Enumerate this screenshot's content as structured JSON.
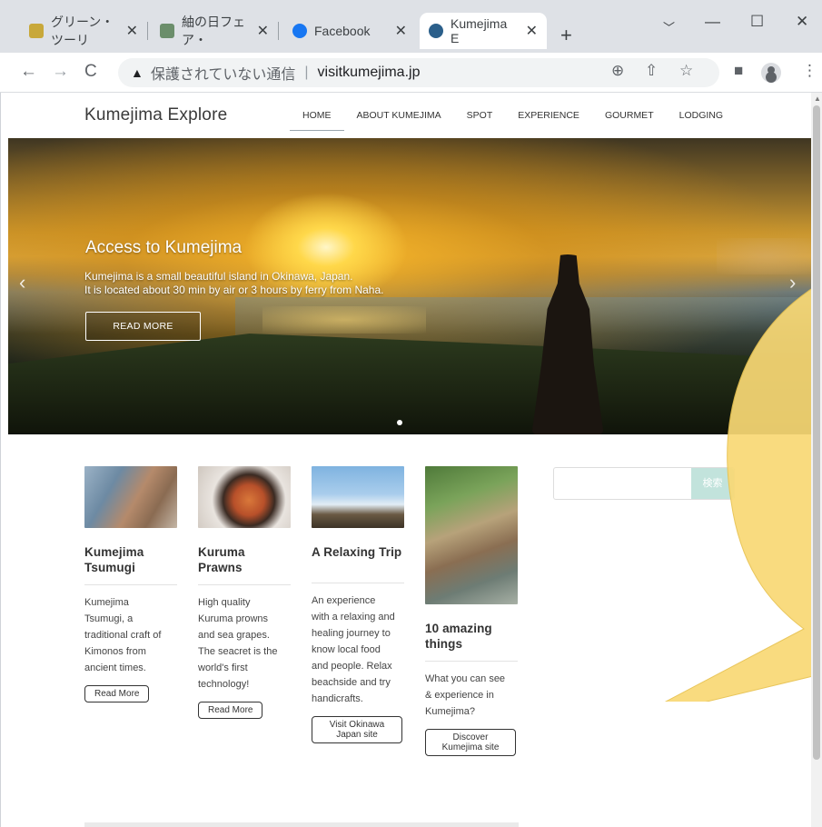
{
  "browser": {
    "tabs": [
      {
        "label": "グリーン・ツーリ",
        "favicon_color": "#c8a83a"
      },
      {
        "label": "紬の日フェア・",
        "favicon_color": "#6b8e6b"
      },
      {
        "label": "Facebook",
        "favicon_color": "#1877f2"
      },
      {
        "label": "Kumejima E",
        "favicon_color": "#2b5f8a"
      }
    ],
    "tab_close_glyph": "✕",
    "new_tab_glyph": "+",
    "window_controls": {
      "tabsearch": "﹀",
      "minimize": "—",
      "maximize": "☐",
      "close": "✕"
    },
    "nav": {
      "back": "←",
      "forward": "→",
      "reload": "C"
    },
    "address": {
      "warning_icon": "▲",
      "insecure_label": "保護されていない通信",
      "separator": "|",
      "url": "visitkumejima.jp"
    },
    "omnibox_icons": {
      "zoom": "⊕",
      "share": "⇧",
      "star": "☆"
    },
    "toolbar_icons": {
      "sidepanel": "■",
      "menu": "⋮"
    }
  },
  "site": {
    "brand": "Kumejima Explore",
    "menu": [
      {
        "label": "HOME",
        "current": true
      },
      {
        "label": "ABOUT KUMEJIMA"
      },
      {
        "label": "SPOT"
      },
      {
        "label": "EXPERIENCE"
      },
      {
        "label": "GOURMET"
      },
      {
        "label": "LODGING"
      }
    ],
    "slider": {
      "title": "Access to Kumejima",
      "line1": "Kumejima is a small beautiful island in Okinawa, Japan.",
      "line2": "It is located about 30 min by air or 3 hours by ferry from Naha.",
      "button": "READ MORE",
      "prev_glyph": "‹",
      "next_glyph": "›"
    },
    "cards": [
      {
        "title_l1": "Kumejima",
        "title_l2": "Tsumugi",
        "desc": [
          "Kumejima",
          "Tsumugi, a",
          "traditional craft of",
          "Kimonos from",
          "ancient times."
        ],
        "button_l1": "Read More",
        "button_l2": ""
      },
      {
        "title_l1": "Kuruma",
        "title_l2": "Prawns",
        "desc": [
          "High quality",
          "Kuruma prowns",
          "and sea grapes.",
          "The seacret is the",
          "world's first",
          "technology!"
        ],
        "button_l1": "Read More",
        "button_l2": ""
      },
      {
        "title_l1": "A Relaxing Trip",
        "title_l2": "",
        "desc": [
          "An experience",
          "with a relaxing and",
          "healing journey to",
          "know local food",
          "and people. Relax",
          "beachside and try",
          "handicrafts."
        ],
        "button_l1": "Visit Okinawa",
        "button_l2": "Japan site"
      },
      {
        "title_l1": "10 amazing",
        "title_l2": "things",
        "desc": [
          "What you can see",
          "& experience in",
          "Kumejima?"
        ],
        "button_l1": "Discover",
        "button_l2": "Kumejima site"
      }
    ],
    "search": {
      "placeholder": "",
      "button": "検索"
    }
  },
  "colors": {
    "callout": "#f9d975",
    "search_button": "#c2e3dc"
  }
}
